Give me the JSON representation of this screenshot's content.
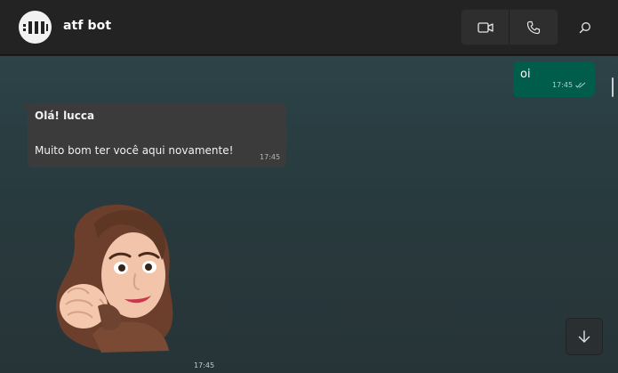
{
  "header": {
    "title": "atf bot",
    "avatar_icon": "bot-logo-icon",
    "video_call_icon": "video-camera-icon",
    "voice_call_icon": "phone-icon",
    "search_icon": "search-icon"
  },
  "messages": {
    "outgoing": {
      "text": "oi",
      "time": "17:45",
      "status_icon": "double-check-icon"
    },
    "incoming": {
      "greeting": "Olá! lucca",
      "body": "Muito bom ter você aqui novamente!",
      "time": "17:45"
    },
    "sticker": {
      "description_icon": "memoji-fist-bump-sticker",
      "time": "17:45"
    }
  },
  "controls": {
    "scroll_down_icon": "arrow-down-icon"
  },
  "colors": {
    "header_bg": "#232323",
    "chat_bg_top": "#2c4347",
    "outgoing_bubble": "#005c4b",
    "incoming_bubble": "#3b3b3b"
  }
}
